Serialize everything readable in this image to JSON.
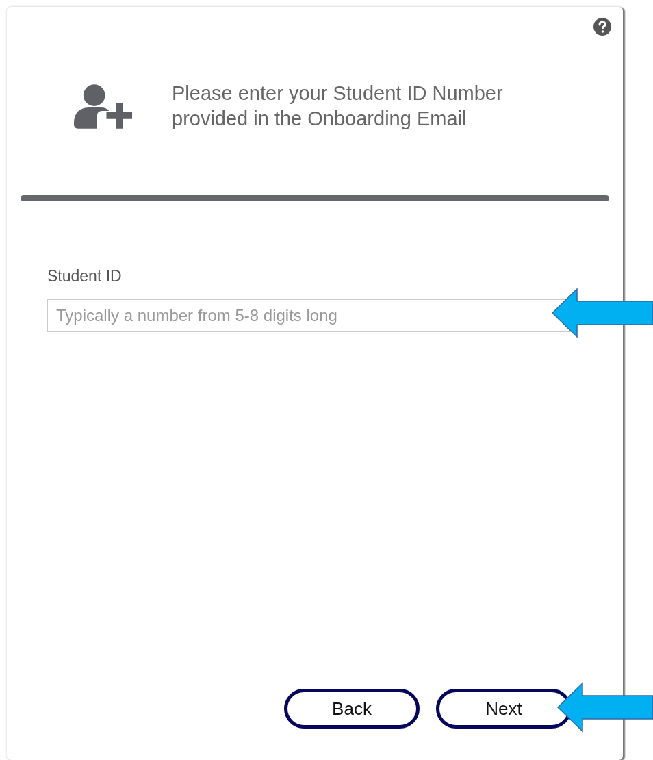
{
  "dialog": {
    "heading": "Please enter your Student ID Number provided in the Onboarding Email",
    "field": {
      "label": "Student ID",
      "placeholder": "Typically a number from 5-8 digits long"
    },
    "buttons": [
      {
        "label": "Back"
      },
      {
        "label": "Next"
      }
    ]
  }
}
